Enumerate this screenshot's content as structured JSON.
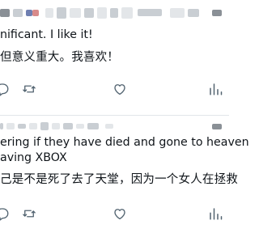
{
  "tweets": [
    {
      "lines": [
        "nificant. I like it!",
        "但意义重大。我喜欢！"
      ]
    },
    {
      "lines": [
        "ering if they have died and gone to heaven",
        "aving XBOX",
        "己是不是死了去了天堂，因为一个女人在拯救"
      ]
    }
  ],
  "icons": {
    "reply": "reply-icon",
    "retweet": "retweet-icon",
    "like": "heart-icon",
    "views": "views-chart-icon",
    "share": "share-icon"
  },
  "colors": {
    "icon": "#536471",
    "text": "#0f1419",
    "divider": "#e1e6ea"
  }
}
